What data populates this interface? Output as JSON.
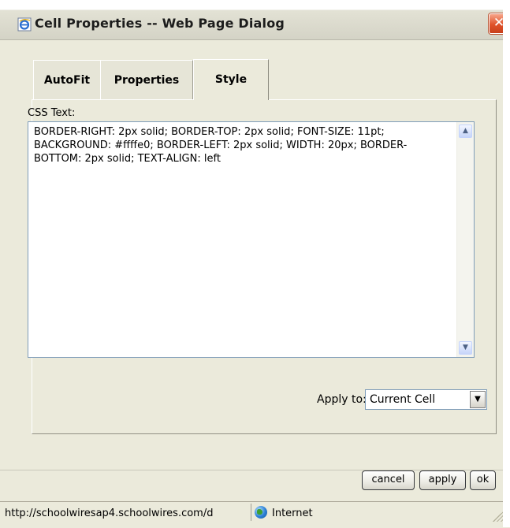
{
  "window": {
    "title": "Cell Properties -- Web Page Dialog",
    "close_glyph": "✕",
    "icon": "ie-page-icon"
  },
  "tabs": [
    {
      "label": "AutoFit",
      "selected": false
    },
    {
      "label": "Properties",
      "selected": false
    },
    {
      "label": "Style",
      "selected": true
    }
  ],
  "style_panel": {
    "css_label": "CSS Text:",
    "css_text": "BORDER-RIGHT: 2px solid; BORDER-TOP: 2px solid; FONT-SIZE: 11pt; BACKGROUND: #ffffe0; BORDER-LEFT: 2px solid; WIDTH: 20px; BORDER-BOTTOM: 2px solid; TEXT-ALIGN: left",
    "apply_to_label": "Apply to:",
    "apply_to_value": "Current Cell"
  },
  "buttons": {
    "cancel": "cancel",
    "apply": "apply",
    "ok": "ok"
  },
  "status_bar": {
    "url": "http://schoolwiresap4.schoolwires.com/d",
    "zone": "Internet"
  },
  "colors": {
    "dialog_bg": "#ebeadb",
    "close_button": "#e0522a",
    "input_border": "#7f9db9"
  }
}
